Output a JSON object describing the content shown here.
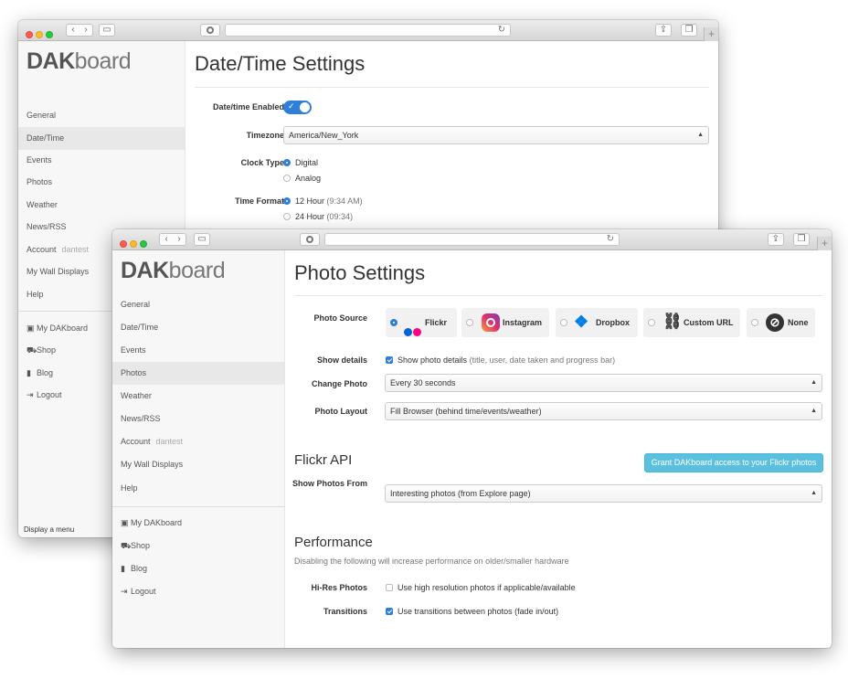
{
  "back": {
    "logo": {
      "bold": "DAK",
      "thin": "board"
    },
    "nav": [
      {
        "label": "General"
      },
      {
        "label": "Date/Time"
      },
      {
        "label": "Events"
      },
      {
        "label": "Photos"
      },
      {
        "label": "Weather"
      },
      {
        "label": "News/RSS"
      },
      {
        "label": "Account",
        "sub": "dantest"
      },
      {
        "label": "My Wall Displays"
      },
      {
        "label": "Help"
      }
    ],
    "links": [
      {
        "label": "My DAKboard"
      },
      {
        "label": "Shop"
      },
      {
        "label": "Blog"
      },
      {
        "label": "Logout"
      }
    ],
    "status": "Display a menu",
    "title": "Date/Time Settings",
    "enabled_label": "Date/time Enabled",
    "timezone_label": "Timezone",
    "timezone_value": "America/New_York",
    "clock_label": "Clock Type",
    "clock_options": [
      "Digital",
      "Analog"
    ],
    "format_label": "Time Format",
    "format_options": [
      {
        "main": "12 Hour",
        "hint": "(9:34 AM)"
      },
      {
        "main": "24 Hour",
        "hint": "(09:34)"
      }
    ]
  },
  "front": {
    "logo": {
      "bold": "DAK",
      "thin": "board"
    },
    "nav": [
      {
        "label": "General"
      },
      {
        "label": "Date/Time"
      },
      {
        "label": "Events"
      },
      {
        "label": "Photos"
      },
      {
        "label": "Weather"
      },
      {
        "label": "News/RSS"
      },
      {
        "label": "Account",
        "sub": "dantest"
      },
      {
        "label": "My Wall Displays"
      },
      {
        "label": "Help"
      }
    ],
    "links": [
      {
        "label": "My DAKboard"
      },
      {
        "label": "Shop"
      },
      {
        "label": "Blog"
      },
      {
        "label": "Logout"
      }
    ],
    "title": "Photo Settings",
    "source_label": "Photo Source",
    "sources": [
      "Flickr",
      "Instagram",
      "Dropbox",
      "Custom URL",
      "None"
    ],
    "details_label": "Show details",
    "details_text": "Show photo details",
    "details_hint": "(title, user, date taken and progress bar)",
    "change_label": "Change Photo",
    "change_value": "Every 30 seconds",
    "layout_label": "Photo Layout",
    "layout_value": "Fill Browser (behind time/events/weather)",
    "flickr_heading": "Flickr API",
    "grant_button": "Grant DAKboard access to your Flickr photos",
    "show_from_label": "Show Photos From",
    "show_from_value": "Interesting photos (from Explore page)",
    "perf_heading": "Performance",
    "perf_desc": "Disabling the following will increase performance on older/smaller hardware",
    "hires_label": "Hi-Res Photos",
    "hires_text": "Use high resolution photos if applicable/available",
    "trans_label": "Transitions",
    "trans_text": "Use transitions between photos (fade in/out)"
  },
  "colors": {
    "accent": "#2f7fd8",
    "info_button": "#5bc0de",
    "flickr_blue": "#0063dc",
    "flickr_pink": "#ff0084",
    "dropbox": "#007ee5"
  }
}
